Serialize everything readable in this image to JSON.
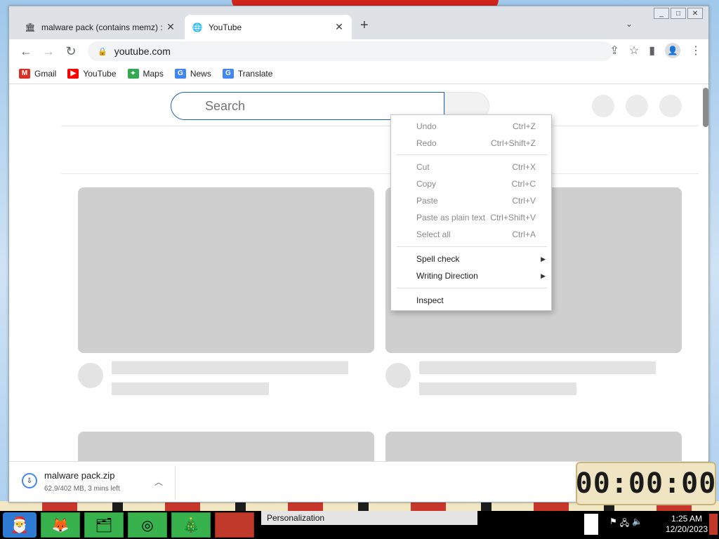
{
  "browser": {
    "tabs": [
      {
        "title": "malware pack (contains memz) :",
        "favicon": "bank-icon",
        "active": false
      },
      {
        "title": "YouTube",
        "favicon": "globe-icon",
        "active": true
      }
    ],
    "new_tab_symbol": "+",
    "tab_search_symbol": "⌄",
    "address": "youtube.com",
    "window_buttons": [
      "_",
      "□",
      "✕"
    ]
  },
  "bookmarks": [
    {
      "label": "Gmail",
      "icon": "gmail-icon",
      "color": "#d93025"
    },
    {
      "label": "YouTube",
      "icon": "youtube-icon",
      "color": "#ff0000"
    },
    {
      "label": "Maps",
      "icon": "maps-icon",
      "color": "#34a853"
    },
    {
      "label": "News",
      "icon": "news-icon",
      "color": "#4285f4"
    },
    {
      "label": "Translate",
      "icon": "translate-icon",
      "color": "#4285f4"
    }
  ],
  "youtube": {
    "search_placeholder": "Search"
  },
  "context_menu": {
    "items": [
      {
        "label": "Undo",
        "shortcut": "Ctrl+Z",
        "enabled": false
      },
      {
        "label": "Redo",
        "shortcut": "Ctrl+Shift+Z",
        "enabled": false
      },
      {
        "label": "Cut",
        "shortcut": "Ctrl+X",
        "enabled": false
      },
      {
        "label": "Copy",
        "shortcut": "Ctrl+C",
        "enabled": false
      },
      {
        "label": "Paste",
        "shortcut": "Ctrl+V",
        "enabled": false
      },
      {
        "label": "Paste as plain text",
        "shortcut": "Ctrl+Shift+V",
        "enabled": false
      },
      {
        "label": "Select all",
        "shortcut": "Ctrl+A",
        "enabled": false
      },
      {
        "label": "Spell check",
        "shortcut": "",
        "enabled": true,
        "submenu": true
      },
      {
        "label": "Writing Direction",
        "shortcut": "",
        "enabled": true,
        "submenu": true
      },
      {
        "label": "Inspect",
        "shortcut": "",
        "enabled": true
      }
    ]
  },
  "download": {
    "filename": "malware pack.zip",
    "status": "62.9/402 MB, 3 mins left"
  },
  "timer": {
    "value": "00:00:00"
  },
  "taskbar": {
    "active_task": "Personalization",
    "time": "1:25 AM",
    "date": "12/20/2023"
  }
}
